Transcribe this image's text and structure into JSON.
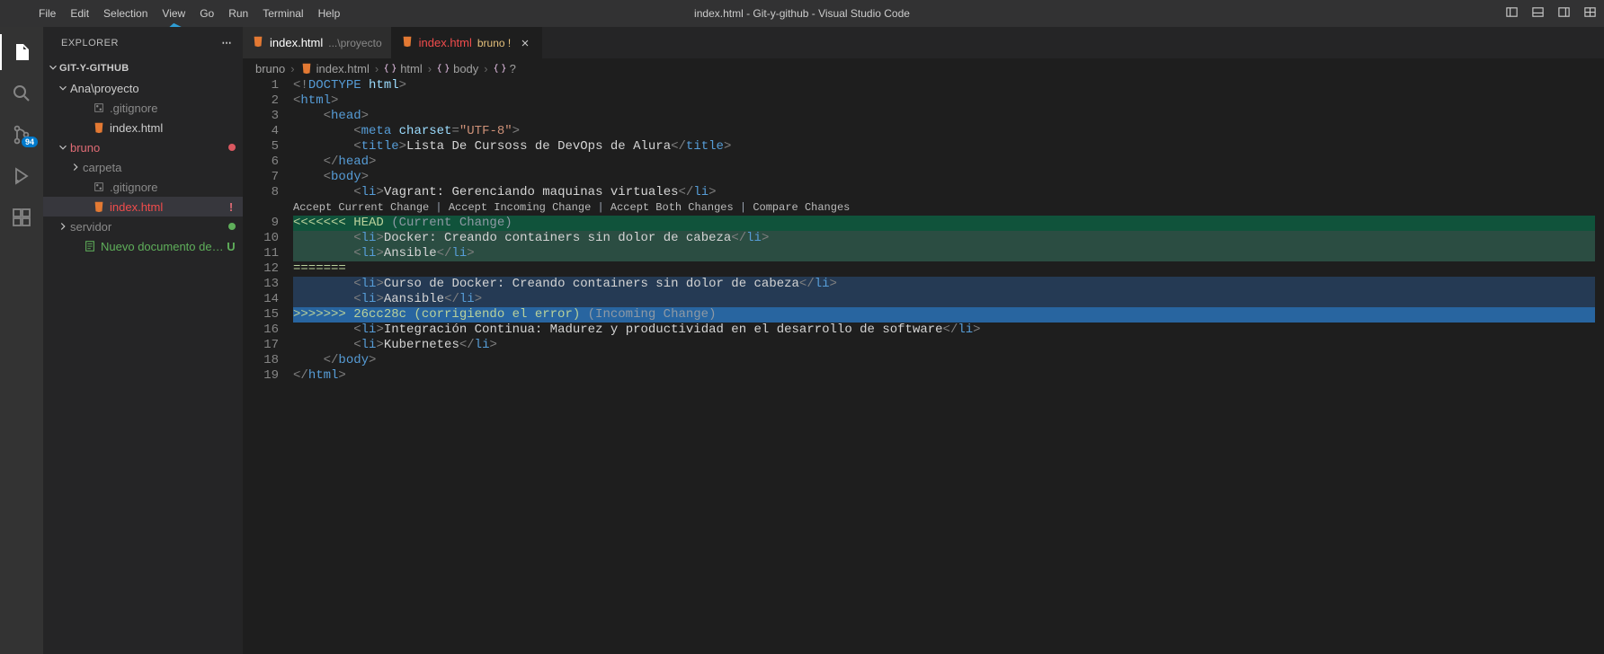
{
  "window": {
    "title": "index.html - Git-y-github - Visual Studio Code"
  },
  "menu": [
    "File",
    "Edit",
    "Selection",
    "View",
    "Go",
    "Run",
    "Terminal",
    "Help"
  ],
  "activity": {
    "scm_badge": "94"
  },
  "sidebar": {
    "title": "EXPLORER",
    "workspace": "GIT-Y-GITHUB",
    "tree": [
      {
        "kind": "folder",
        "open": true,
        "indent": 1,
        "label": "Ana\\proyecto",
        "color": ""
      },
      {
        "kind": "file",
        "indent": 3,
        "icon": "git",
        "label": ".gitignore",
        "color": "c-gitignore"
      },
      {
        "kind": "file",
        "indent": 3,
        "icon": "html",
        "label": "index.html",
        "color": ""
      },
      {
        "kind": "folder",
        "open": true,
        "indent": 1,
        "label": "bruno",
        "color": "c-bruno",
        "dot": "#db5860"
      },
      {
        "kind": "folder",
        "open": false,
        "indent": 2,
        "label": "carpeta",
        "color": "c-dim"
      },
      {
        "kind": "file",
        "indent": 3,
        "icon": "git",
        "label": ".gitignore",
        "color": "c-gitignore"
      },
      {
        "kind": "file",
        "indent": 3,
        "icon": "html",
        "label": "index.html",
        "color": "c-err",
        "selected": true,
        "status": "!",
        "statusColor": "#e06c75"
      },
      {
        "kind": "folder",
        "open": false,
        "indent": 1,
        "label": "servidor",
        "color": "c-dim",
        "dot": "#5faf5a"
      },
      {
        "kind": "file",
        "indent": 2,
        "icon": "txt",
        "label": "Nuevo documento de texto.txt",
        "color": "c-u",
        "status": "U",
        "statusColor": "#5faf5a"
      }
    ]
  },
  "tabs": [
    {
      "icon": "html",
      "name": "index.html",
      "desc": "...\\proyecto",
      "active": false,
      "err": false,
      "close": false
    },
    {
      "icon": "html",
      "name": "index.html",
      "desc": "bruno !",
      "active": true,
      "err": true,
      "close": true,
      "nameColor": "#f14c4c"
    }
  ],
  "breadcrumbs": [
    {
      "text": "bruno"
    },
    {
      "icon": "html",
      "text": "index.html"
    },
    {
      "icon": "sym",
      "text": "html"
    },
    {
      "icon": "sym",
      "text": "body"
    },
    {
      "icon": "sym",
      "text": "?"
    }
  ],
  "codelens": {
    "a": "Accept Current Change",
    "b": "Accept Incoming Change",
    "c": "Accept Both Changes",
    "d": "Compare Changes"
  },
  "code": {
    "lines": [
      {
        "n": 1,
        "seg": [
          [
            "pun",
            "<!"
          ],
          [
            "tag",
            "DOCTYPE "
          ],
          [
            "attr",
            "html"
          ],
          [
            "pun",
            ">"
          ]
        ]
      },
      {
        "n": 2,
        "seg": [
          [
            "pun",
            "<"
          ],
          [
            "tag",
            "html"
          ],
          [
            "pun",
            ">"
          ]
        ]
      },
      {
        "n": 3,
        "seg": [
          [
            "txt",
            "    "
          ],
          [
            "pun",
            "<"
          ],
          [
            "tag",
            "head"
          ],
          [
            "pun",
            ">"
          ]
        ]
      },
      {
        "n": 4,
        "seg": [
          [
            "txt",
            "        "
          ],
          [
            "pun",
            "<"
          ],
          [
            "tag",
            "meta "
          ],
          [
            "attr",
            "charset"
          ],
          [
            "pun",
            "="
          ],
          [
            "str",
            "\"UTF-8\""
          ],
          [
            "pun",
            ">"
          ]
        ]
      },
      {
        "n": 5,
        "seg": [
          [
            "txt",
            "        "
          ],
          [
            "pun",
            "<"
          ],
          [
            "tag",
            "title"
          ],
          [
            "pun",
            ">"
          ],
          [
            "txt",
            "Lista De Cursoss de DevOps de Alura"
          ],
          [
            "pun",
            "</"
          ],
          [
            "tag",
            "title"
          ],
          [
            "pun",
            ">"
          ]
        ]
      },
      {
        "n": 6,
        "seg": [
          [
            "txt",
            "    "
          ],
          [
            "pun",
            "</"
          ],
          [
            "tag",
            "head"
          ],
          [
            "pun",
            ">"
          ]
        ]
      },
      {
        "n": 7,
        "seg": [
          [
            "txt",
            "    "
          ],
          [
            "pun",
            "<"
          ],
          [
            "tag",
            "body"
          ],
          [
            "pun",
            ">"
          ]
        ]
      },
      {
        "n": 8,
        "seg": [
          [
            "txt",
            "        "
          ],
          [
            "pun",
            "<"
          ],
          [
            "tag",
            "li"
          ],
          [
            "pun",
            ">"
          ],
          [
            "txt",
            "Vagrant: Gerenciando maquinas virtuales"
          ],
          [
            "pun",
            "</"
          ],
          [
            "tag",
            "li"
          ],
          [
            "pun",
            ">"
          ]
        ]
      },
      {
        "n": "lens"
      },
      {
        "n": 9,
        "cls": "hl-greenbar",
        "seg": [
          [
            "marker",
            "<<<<<<< HEAD "
          ],
          [
            "note",
            "(Current Change)"
          ]
        ]
      },
      {
        "n": 10,
        "cls": "hl-green",
        "seg": [
          [
            "txt",
            "        "
          ],
          [
            "pun",
            "<"
          ],
          [
            "tag",
            "li"
          ],
          [
            "pun",
            ">"
          ],
          [
            "txt",
            "Docker: Creando containers sin dolor de cabeza"
          ],
          [
            "pun",
            "</"
          ],
          [
            "tag",
            "li"
          ],
          [
            "pun",
            ">"
          ]
        ]
      },
      {
        "n": 11,
        "cls": "hl-green",
        "seg": [
          [
            "txt",
            "        "
          ],
          [
            "pun",
            "<"
          ],
          [
            "tag",
            "li"
          ],
          [
            "pun",
            ">"
          ],
          [
            "txt",
            "Ansible"
          ],
          [
            "pun",
            "</"
          ],
          [
            "tag",
            "li"
          ],
          [
            "pun",
            ">"
          ]
        ]
      },
      {
        "n": 12,
        "seg": [
          [
            "marker",
            "======="
          ]
        ]
      },
      {
        "n": 13,
        "cls": "hl-blue",
        "seg": [
          [
            "txt",
            "        "
          ],
          [
            "pun",
            "<"
          ],
          [
            "tag",
            "li"
          ],
          [
            "pun",
            ">"
          ],
          [
            "txt",
            "Curso de Docker: Creando containers sin dolor de cabeza"
          ],
          [
            "pun",
            "</"
          ],
          [
            "tag",
            "li"
          ],
          [
            "pun",
            ">"
          ]
        ]
      },
      {
        "n": 14,
        "cls": "hl-blue",
        "seg": [
          [
            "txt",
            "        "
          ],
          [
            "pun",
            "<"
          ],
          [
            "tag",
            "li"
          ],
          [
            "pun",
            ">"
          ],
          [
            "txt",
            "Aansible"
          ],
          [
            "pun",
            "</"
          ],
          [
            "tag",
            "li"
          ],
          [
            "pun",
            ">"
          ]
        ]
      },
      {
        "n": 15,
        "cls": "hl-bluebar",
        "seg": [
          [
            "marker",
            ">>>>>>> 26cc28c (corrigiendo el error) "
          ],
          [
            "note",
            "(Incoming Change)"
          ]
        ]
      },
      {
        "n": 16,
        "seg": [
          [
            "txt",
            "        "
          ],
          [
            "pun",
            "<"
          ],
          [
            "tag",
            "li"
          ],
          [
            "pun",
            ">"
          ],
          [
            "txt",
            "Integración Continua: Madurez y productividad en el desarrollo de software"
          ],
          [
            "pun",
            "</"
          ],
          [
            "tag",
            "li"
          ],
          [
            "pun",
            ">"
          ]
        ]
      },
      {
        "n": 17,
        "seg": [
          [
            "txt",
            "        "
          ],
          [
            "pun",
            "<"
          ],
          [
            "tag",
            "li"
          ],
          [
            "pun",
            ">"
          ],
          [
            "txt",
            "Kubernetes"
          ],
          [
            "pun",
            "</"
          ],
          [
            "tag",
            "li"
          ],
          [
            "pun",
            ">"
          ]
        ]
      },
      {
        "n": 18,
        "seg": [
          [
            "txt",
            "    "
          ],
          [
            "pun",
            "</"
          ],
          [
            "tag",
            "body"
          ],
          [
            "pun",
            ">"
          ]
        ]
      },
      {
        "n": 19,
        "seg": [
          [
            "pun",
            "</"
          ],
          [
            "tag",
            "html"
          ],
          [
            "pun",
            ">"
          ]
        ]
      }
    ]
  }
}
